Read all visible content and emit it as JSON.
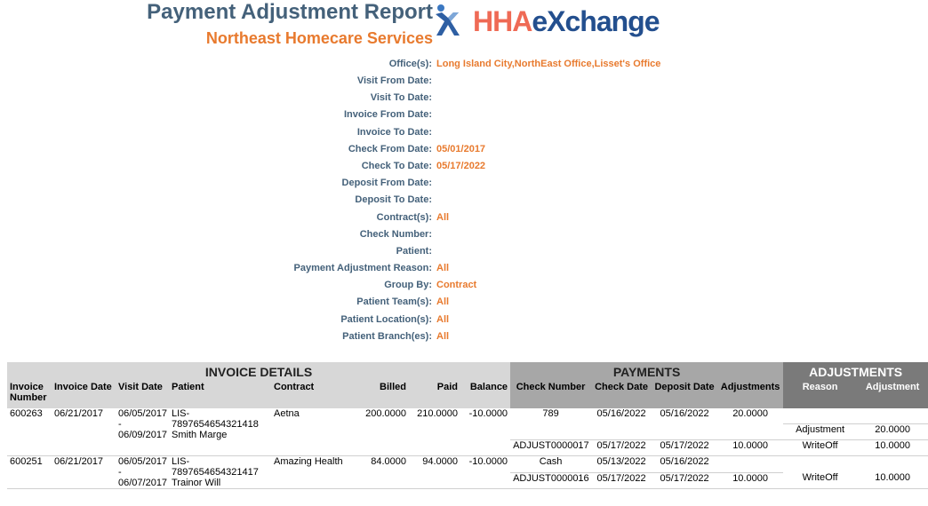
{
  "header": {
    "title": "Payment Adjustment Report",
    "company": "Northeast Homecare Services",
    "logo": {
      "part1": "HHA",
      "part2": "eXchange",
      "icon": "hha-x-logo-icon"
    }
  },
  "params": [
    {
      "label": "Office(s):",
      "value": "Long Island City,NorthEast Office,Lisset's Office"
    },
    {
      "label": "Visit From Date:",
      "value": ""
    },
    {
      "label": "Visit To Date:",
      "value": ""
    },
    {
      "label": "Invoice From Date:",
      "value": ""
    },
    {
      "label": "Invoice To Date:",
      "value": ""
    },
    {
      "label": "Check From Date:",
      "value": "05/01/2017"
    },
    {
      "label": "Check To Date:",
      "value": "05/17/2022"
    },
    {
      "label": "Deposit From Date:",
      "value": ""
    },
    {
      "label": "Deposit To Date:",
      "value": ""
    },
    {
      "label": "Contract(s):",
      "value": "All"
    },
    {
      "label": "Check Number:",
      "value": ""
    },
    {
      "label": "Patient:",
      "value": ""
    },
    {
      "label": "Payment Adjustment Reason:",
      "value": "All"
    },
    {
      "label": "Group By:",
      "value": "Contract"
    },
    {
      "label": "Patient Team(s):",
      "value": "All"
    },
    {
      "label": "Patient Location(s):",
      "value": "All"
    },
    {
      "label": "Patient Branch(es):",
      "value": "All"
    }
  ],
  "table": {
    "groups": {
      "invoice": "INVOICE DETAILS",
      "payments": "PAYMENTS",
      "adjustments": "ADJUSTMENTS"
    },
    "columns": {
      "invoice_number": "Invoice Number",
      "invoice_date": "Invoice Date",
      "visit_date": "Visit Date",
      "patient": "Patient",
      "contract": "Contract",
      "billed": "Billed",
      "paid": "Paid",
      "balance": "Balance",
      "check_number": "Check Number",
      "check_date": "Check Date",
      "deposit_date": "Deposit Date",
      "adjustments": "Adjustments",
      "reason": "Reason",
      "adjustment": "Adjustment"
    },
    "invoices": [
      {
        "invoice_number": "600263",
        "invoice_date": "06/21/2017",
        "visit_from": "06/05/2017",
        "visit_sep": "-",
        "visit_to": "06/09/2017",
        "patient_id1": "LIS-",
        "patient_id2": "7897654654321418",
        "patient_name": "Smith Marge",
        "contract": "Aetna",
        "billed": "200.0000",
        "paid": "210.0000",
        "balance": "-10.0000",
        "payments": [
          {
            "check_number": "789",
            "check_date": "05/16/2022",
            "deposit_date": "05/16/2022",
            "adjustments": "20.0000"
          },
          {
            "check_number": "ADJUST0000017",
            "check_date": "05/17/2022",
            "deposit_date": "05/17/2022",
            "adjustments": "10.0000"
          }
        ],
        "adjustments": [
          {
            "reason": "Adjustment",
            "amount": "20.0000"
          },
          {
            "reason": "WriteOff",
            "amount": "10.0000"
          }
        ]
      },
      {
        "invoice_number": "600251",
        "invoice_date": "06/21/2017",
        "visit_from": "06/05/2017",
        "visit_sep": "-",
        "visit_to": "06/07/2017",
        "patient_id1": "LIS-",
        "patient_id2": "7897654654321417",
        "patient_name": "Trainor Will",
        "contract": "Amazing Health",
        "billed": "84.0000",
        "paid": "94.0000",
        "balance": "-10.0000",
        "payments": [
          {
            "check_number": "Cash",
            "check_date": "05/13/2022",
            "deposit_date": "05/16/2022",
            "adjustments": ""
          },
          {
            "check_number": "ADJUST0000016",
            "check_date": "05/17/2022",
            "deposit_date": "05/17/2022",
            "adjustments": "10.0000"
          }
        ],
        "adjustments": [
          {
            "reason": "WriteOff",
            "amount": "10.0000"
          }
        ]
      }
    ]
  }
}
